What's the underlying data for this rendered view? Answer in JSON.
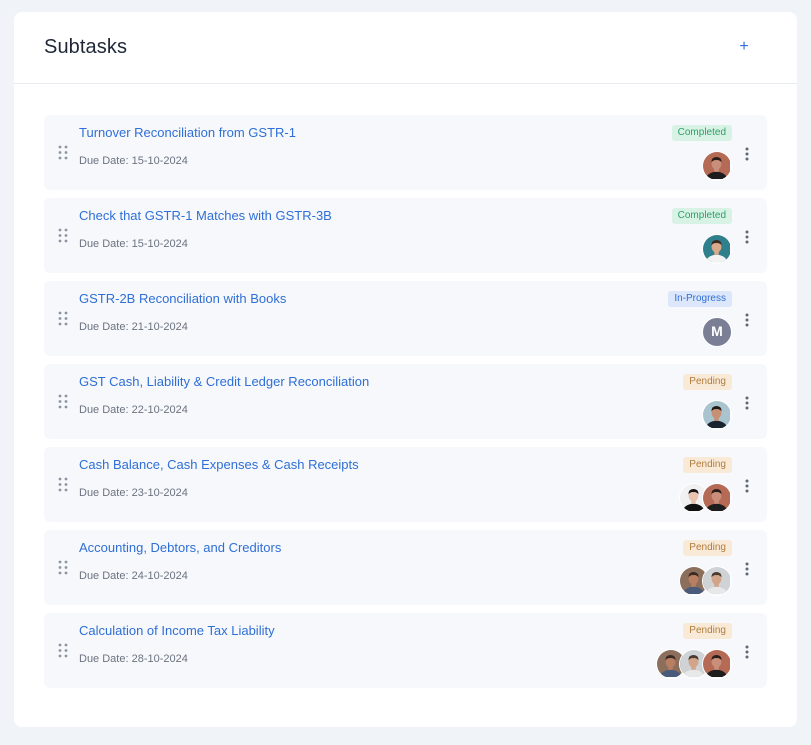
{
  "header": {
    "title": "Subtasks",
    "add_label": "+"
  },
  "tasks": [
    {
      "title": "Turnover Reconciliation from GSTR-1",
      "due": "Due Date: 15-10-2024",
      "status": "Completed",
      "status_kind": "completed",
      "assignees": [
        {
          "type": "photo",
          "skin": "#c98f7a",
          "hair": "#2b1d17",
          "shirt": "#1d1d1d",
          "bg": "#b56a55"
        }
      ]
    },
    {
      "title": "Check that GSTR-1 Matches with GSTR-3B",
      "due": "Due Date: 15-10-2024",
      "status": "Completed",
      "status_kind": "completed",
      "assignees": [
        {
          "type": "photo",
          "skin": "#d9a98c",
          "hair": "#3b2b22",
          "shirt": "#f2f2f2",
          "bg": "#2f7f8c"
        }
      ]
    },
    {
      "title": "GSTR-2B Reconciliation with Books",
      "due": "Due Date: 21-10-2024",
      "status": "In-Progress",
      "status_kind": "inprogress",
      "assignees": [
        {
          "type": "initial",
          "letter": "M"
        }
      ]
    },
    {
      "title": "GST Cash, Liability & Credit Ledger Reconciliation",
      "due": "Due Date: 22-10-2024",
      "status": "Pending",
      "status_kind": "pending",
      "assignees": [
        {
          "type": "photo",
          "skin": "#c69074",
          "hair": "#1e1a18",
          "shirt": "#1a2430",
          "bg": "#a9c3cf"
        }
      ]
    },
    {
      "title": "Cash Balance, Cash Expenses & Cash Receipts",
      "due": "Due Date: 23-10-2024",
      "status": "Pending",
      "status_kind": "pending",
      "assignees": [
        {
          "type": "photo",
          "skin": "#c98f7a",
          "hair": "#2b1d17",
          "shirt": "#1d1d1d",
          "bg": "#b56a55"
        },
        {
          "type": "photo",
          "skin": "#e8c4b0",
          "hair": "#141414",
          "shirt": "#111111",
          "bg": "#f1f1f1"
        }
      ]
    },
    {
      "title": "Accounting, Debtors, and Creditors",
      "due": "Due Date: 24-10-2024",
      "status": "Pending",
      "status_kind": "pending",
      "assignees": [
        {
          "type": "photo",
          "skin": "#d2a48a",
          "hair": "#4a3a30",
          "shirt": "#e8e8e8",
          "bg": "#cfd3d6"
        },
        {
          "type": "photo",
          "skin": "#b97f62",
          "hair": "#3a2a22",
          "shirt": "#4a5a7a",
          "bg": "#8b6e5c"
        }
      ]
    },
    {
      "title": "Calculation of Income Tax Liability",
      "due": "Due Date: 28-10-2024",
      "status": "Pending",
      "status_kind": "pending",
      "assignees": [
        {
          "type": "photo",
          "skin": "#c98f7a",
          "hair": "#2b1d17",
          "shirt": "#1d1d1d",
          "bg": "#b56a55"
        },
        {
          "type": "photo",
          "skin": "#d2a48a",
          "hair": "#4a3a30",
          "shirt": "#e8e8e8",
          "bg": "#cfd3d6"
        },
        {
          "type": "photo",
          "skin": "#b97f62",
          "hair": "#3a2a22",
          "shirt": "#4a5a7a",
          "bg": "#8b6e5c"
        }
      ]
    }
  ],
  "colors": {
    "accent": "#2f6fd6",
    "completed": "#2e9e64",
    "inprogress": "#2f6fd6",
    "pending": "#b07c3e"
  },
  "icons": {
    "drag": "drag-handle-icon",
    "more": "more-vertical-icon",
    "add": "plus-icon"
  }
}
